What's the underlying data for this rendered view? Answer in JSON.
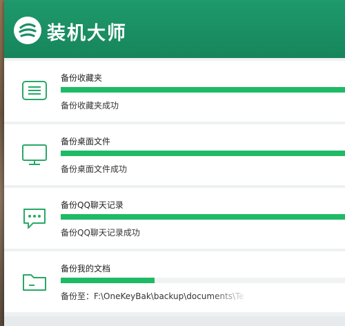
{
  "app": {
    "title": "装机大师"
  },
  "colors": {
    "brand": "#1a8f63",
    "progress": "#1fba66",
    "icon": "#27a866"
  },
  "tasks": [
    {
      "icon": "list-icon",
      "name": "备份收藏夹",
      "progress": 1.0,
      "status": "备份收藏夹成功"
    },
    {
      "icon": "monitor-icon",
      "name": "备份桌面文件",
      "progress": 1.0,
      "status": "备份桌面文件成功"
    },
    {
      "icon": "chat-icon",
      "name": "备份QQ聊天记录",
      "progress": 1.0,
      "status": "备份QQ聊天记录成功"
    },
    {
      "icon": "folder-icon",
      "name": "备份我的文档",
      "progress": 0.33,
      "status": "备份至：F:\\OneKeyBak\\backup\\documents\\Tence"
    }
  ]
}
